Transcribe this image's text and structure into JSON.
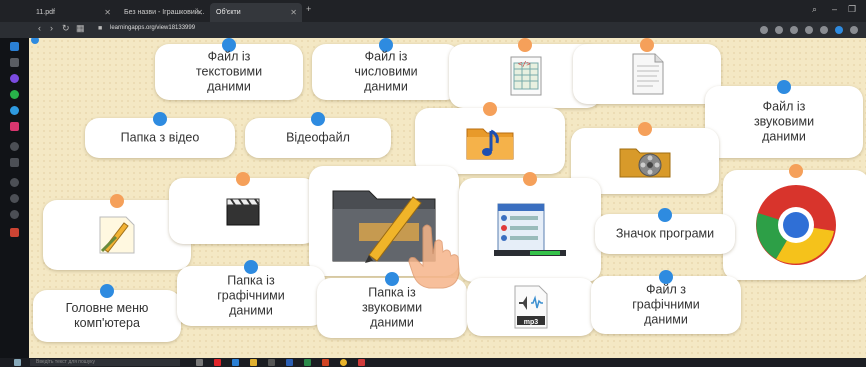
{
  "browser": {
    "tabs": [
      {
        "label": "11.pdf"
      },
      {
        "label": "Без назви - Іграшковий..."
      },
      {
        "label": "Об'єкти"
      }
    ],
    "address": "learningapps.org/view18133999"
  },
  "game": {
    "cards": {
      "text_file": "Файл із\nтекстовими\nданими",
      "number_file": "Файл із\nчисловими\nданими",
      "sound_file_right": "Файл із\nзвуковими\nданими",
      "video_folder": "Папка з відео",
      "video_file": "Відеофайл",
      "program_icon": "Значок програми",
      "graphics_folder": "Папка із\nграфічними\nданими",
      "sound_folder": "Папка із\nзвуковими\nданими",
      "graphics_file": "Файл з\nграфічними\nданими",
      "main_menu": "Головне меню\nкомп'ютера"
    },
    "image_labels": {
      "mp3": "mp3"
    },
    "colors": {
      "board": "#f4e8c4",
      "card": "#ffffff",
      "dot_blue": "#2e8be0",
      "dot_orange": "#f5a05a"
    }
  },
  "taskbar": {
    "search_placeholder": "Введіть текст для пошуку"
  }
}
